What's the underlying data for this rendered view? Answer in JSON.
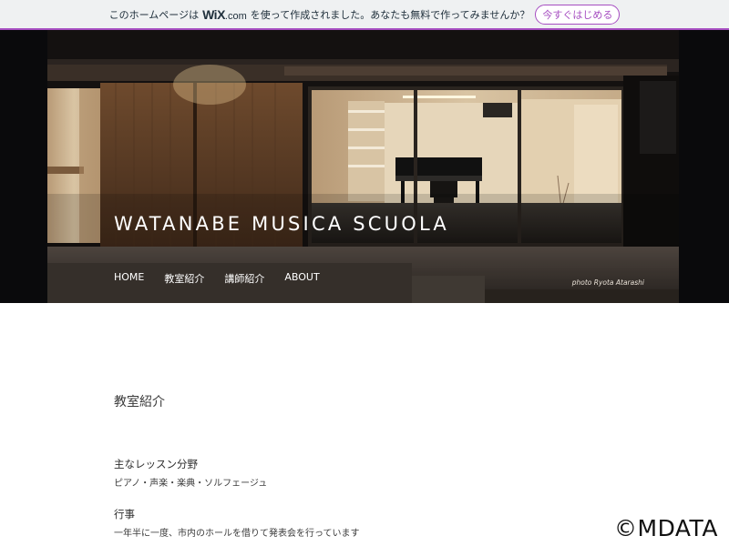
{
  "wix_bar": {
    "pre_text": "このホームページは",
    "logo_main": "WiX",
    "logo_suffix": ".com",
    "post_text": "を使って作成されました。あなたも無料で作ってみませんか？",
    "cta_label": "今すぐはじめる",
    "accent": "#a64ec1"
  },
  "site": {
    "title": "WATANABE MUSICA SCUOLA",
    "photo_credit": "photo Ryota Atarashi"
  },
  "nav": {
    "items": [
      "HOME",
      "教室紹介",
      "講師紹介",
      "ABOUT"
    ]
  },
  "content": {
    "section_title": "教室紹介",
    "blocks": [
      {
        "heading": "主なレッスン分野",
        "text": "ピアノ・声楽・楽典・ソルフェージュ"
      },
      {
        "heading": "行事",
        "text": "一年半に一度、市内のホールを借りて発表会を行っています"
      }
    ]
  },
  "watermark": "©MDATA"
}
